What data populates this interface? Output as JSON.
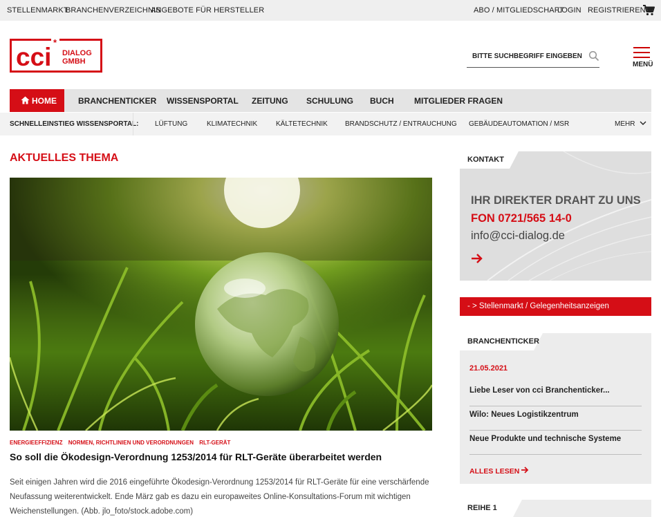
{
  "topbar": {
    "left_links": [
      "STELLENMARKT",
      "BRANCHENVERZEICHNIS",
      "ANGEBOTE FÜR HERSTELLER"
    ],
    "right_links": [
      "ABO / MITGLIEDSCHAFT",
      "LOGIN",
      "REGISTRIEREN"
    ],
    "cart_icon": "shopping-cart-icon"
  },
  "logo": {
    "brand": "cci",
    "line1": "DIALOG",
    "line2": "GMBH"
  },
  "search": {
    "placeholder": "BITTE SUCHBEGRIFF EINGEBEN",
    "icon": "search-icon"
  },
  "menu": {
    "label": "MENÜ",
    "icon": "hamburger-icon"
  },
  "main_nav": {
    "home": "HOME",
    "items": [
      "BRANCHENTICKER",
      "WISSENSPORTAL",
      "ZEITUNG",
      "SCHULUNG",
      "BUCH",
      "MITGLIEDER FRAGEN"
    ]
  },
  "quick_nav": {
    "label": "SCHNELLEINSTIEG WISSENSPORTAL:",
    "items": [
      "LÜFTUNG",
      "KLIMATECHNIK",
      "KÄLTETECHNIK",
      "BRANDSCHUTZ / ENTRAUCHUNG",
      "GEBÄUDEAUTOMATION / MSR"
    ],
    "more": "MEHR"
  },
  "main": {
    "section_title": "AKTUELLES THEMA",
    "tags": [
      "ENERGIEEFFIZIENZ",
      "NORMEN, RICHTLINIEN UND VERORDNUNGEN",
      "RLT-GERÄT"
    ],
    "article_title": "So soll die Ökodesign-Verordnung 1253/2014 für RLT-Geräte überarbeitet werden",
    "teaser_lines": [
      "Seit einigen Jahren wird die 2016 eingeführte Ökodesign-Verordnung 1253/2014 für RLT-Geräte für eine verschärfende",
      "Neufassung weiterentwickelt. Ende März gab es dazu ein europaweites Online-Konsultations-Forum mit wichtigen",
      "Weichenstellungen. (Abb. jlo_foto/stock.adobe.com)"
    ]
  },
  "sidebar": {
    "contact": {
      "label": "KONTAKT",
      "headline": "IHR DIREKTER DRAHT ZU UNS",
      "phone": "FON 0721/565 14-0",
      "email": "info@cci-dialog.de"
    },
    "jobs_button": "- > Stellenmarkt / Gelegenheitsanzeigen",
    "ticker": {
      "label": "BRANCHENTICKER",
      "date": "21.05.2021",
      "entries": [
        "Liebe Leser von cci Branchenticker...",
        "Wilo: Neues Logistikzentrum",
        "Neue Produkte und technische Systeme"
      ],
      "read_all": "ALLES LESEN"
    },
    "reihe_label": "REIHE 1"
  },
  "colors": {
    "accent": "#d50e16",
    "nav_bg": "#e4e4e4",
    "topbar_bg": "#efefef"
  }
}
